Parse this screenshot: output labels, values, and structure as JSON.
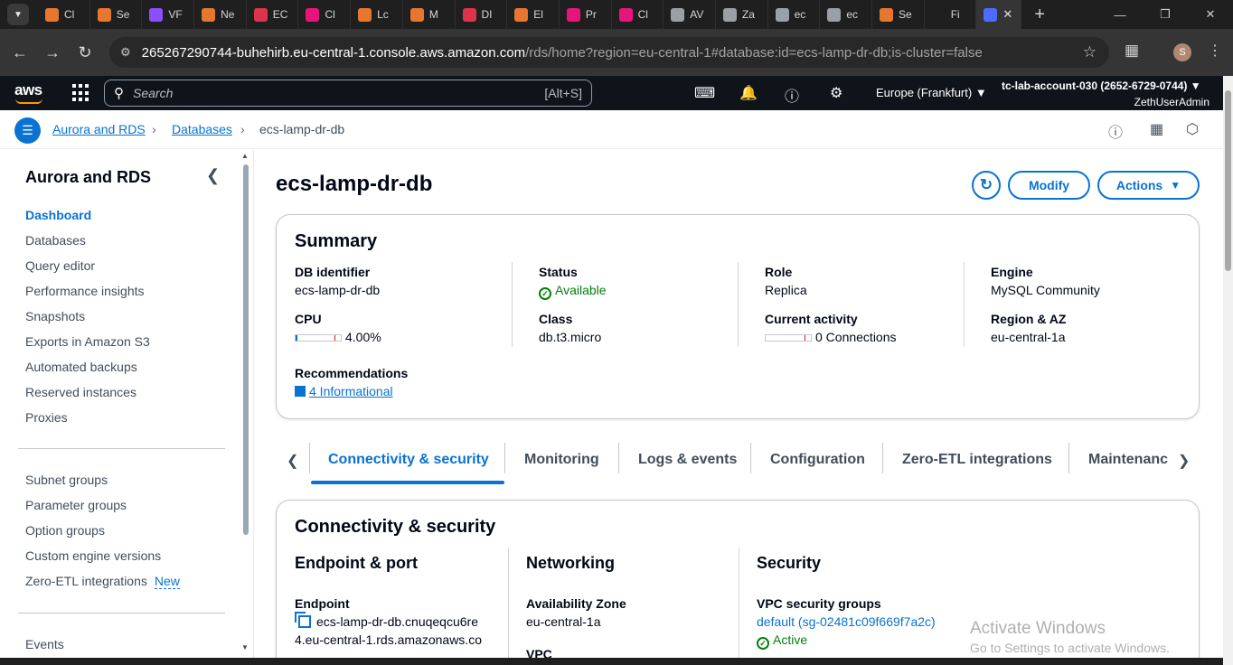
{
  "browser": {
    "tabs": [
      {
        "title": "Cl",
        "color": "#e7762e"
      },
      {
        "title": "Se",
        "color": "#e7762e"
      },
      {
        "title": "VF",
        "color": "#8c4fff"
      },
      {
        "title": "Ne",
        "color": "#e7762e"
      },
      {
        "title": "EC",
        "color": "#dd344c"
      },
      {
        "title": "Cl",
        "color": "#e7157b"
      },
      {
        "title": "Lc",
        "color": "#e7762e"
      },
      {
        "title": "M",
        "color": "#e7762e"
      },
      {
        "title": "DI",
        "color": "#dd344c"
      },
      {
        "title": "El",
        "color": "#e7762e"
      },
      {
        "title": "Pr",
        "color": "#e7157b"
      },
      {
        "title": "Cl",
        "color": "#e7157b"
      },
      {
        "title": "AV",
        "color": "#9aa0a6"
      },
      {
        "title": "Za",
        "color": "#9aa0a6"
      },
      {
        "title": "ec",
        "color": "#9aa0a6"
      },
      {
        "title": "ec",
        "color": "#9aa0a6"
      },
      {
        "title": "Se",
        "color": "#e7762e"
      },
      {
        "title": "Fi",
        "color": "#1f1f1f"
      }
    ],
    "active_tab": {
      "title": "",
      "color": "#4d6bfe"
    },
    "url_host": "265267290744-buhehirb.eu-central-1.console.aws.amazon.com",
    "url_rest": "/rds/home?region=eu-central-1#database:id=ecs-lamp-dr-db;is-cluster=false",
    "profile_initial": "S"
  },
  "awsnav": {
    "logo": "aws",
    "search_placeholder": "Search",
    "search_shortcut": "[Alt+S]",
    "region": "Europe (Frankfurt)",
    "account": "tc-lab-account-030 (2652-6729-0744)",
    "user": "ZethUserAdmin"
  },
  "breadcrumb": {
    "items": [
      "Aurora and RDS",
      "Databases",
      "ecs-lamp-dr-db"
    ]
  },
  "sidenav": {
    "title": "Aurora and RDS",
    "group1": [
      "Dashboard",
      "Databases",
      "Query editor",
      "Performance insights",
      "Snapshots",
      "Exports in Amazon S3",
      "Automated backups",
      "Reserved instances",
      "Proxies"
    ],
    "group2": [
      "Subnet groups",
      "Parameter groups",
      "Option groups",
      "Custom engine versions",
      "Zero-ETL integrations"
    ],
    "new_badge": "New",
    "group3": [
      "Events"
    ]
  },
  "page": {
    "title": "ecs-lamp-dr-db",
    "modify_label": "Modify",
    "actions_label": "Actions"
  },
  "summary": {
    "title": "Summary",
    "db_identifier_label": "DB identifier",
    "db_identifier": "ecs-lamp-dr-db",
    "status_label": "Status",
    "status": "Available",
    "role_label": "Role",
    "role": "Replica",
    "engine_label": "Engine",
    "engine": "MySQL Community",
    "cpu_label": "CPU",
    "cpu": "4.00%",
    "cpu_fraction": 0.04,
    "class_label": "Class",
    "class": "db.t3.micro",
    "activity_label": "Current activity",
    "activity": "0 Connections",
    "activity_fraction": 0,
    "region_label": "Region & AZ",
    "region": "eu-central-1a",
    "recommendations_label": "Recommendations",
    "recommendations": "4 Informational"
  },
  "tabs": {
    "items": [
      "Connectivity & security",
      "Monitoring",
      "Logs & events",
      "Configuration",
      "Zero-ETL integrations",
      "Maintenanc"
    ]
  },
  "connectivity": {
    "title": "Connectivity & security",
    "endpoint_heading": "Endpoint & port",
    "endpoint_label": "Endpoint",
    "endpoint_line1": "ecs-lamp-dr-db.cnuqeqcu6re",
    "endpoint_line2": "4.eu-central-1.rds.amazonaws.co",
    "networking_heading": "Networking",
    "az_label": "Availability Zone",
    "az": "eu-central-1a",
    "vpc_label": "VPC",
    "security_heading": "Security",
    "sg_label": "VPC security groups",
    "sg": "default (sg-02481c09f669f7a2c)",
    "sg_status": "Active"
  },
  "watermark": {
    "line1": "Activate Windows",
    "line2": "Go to Settings to activate Windows."
  }
}
